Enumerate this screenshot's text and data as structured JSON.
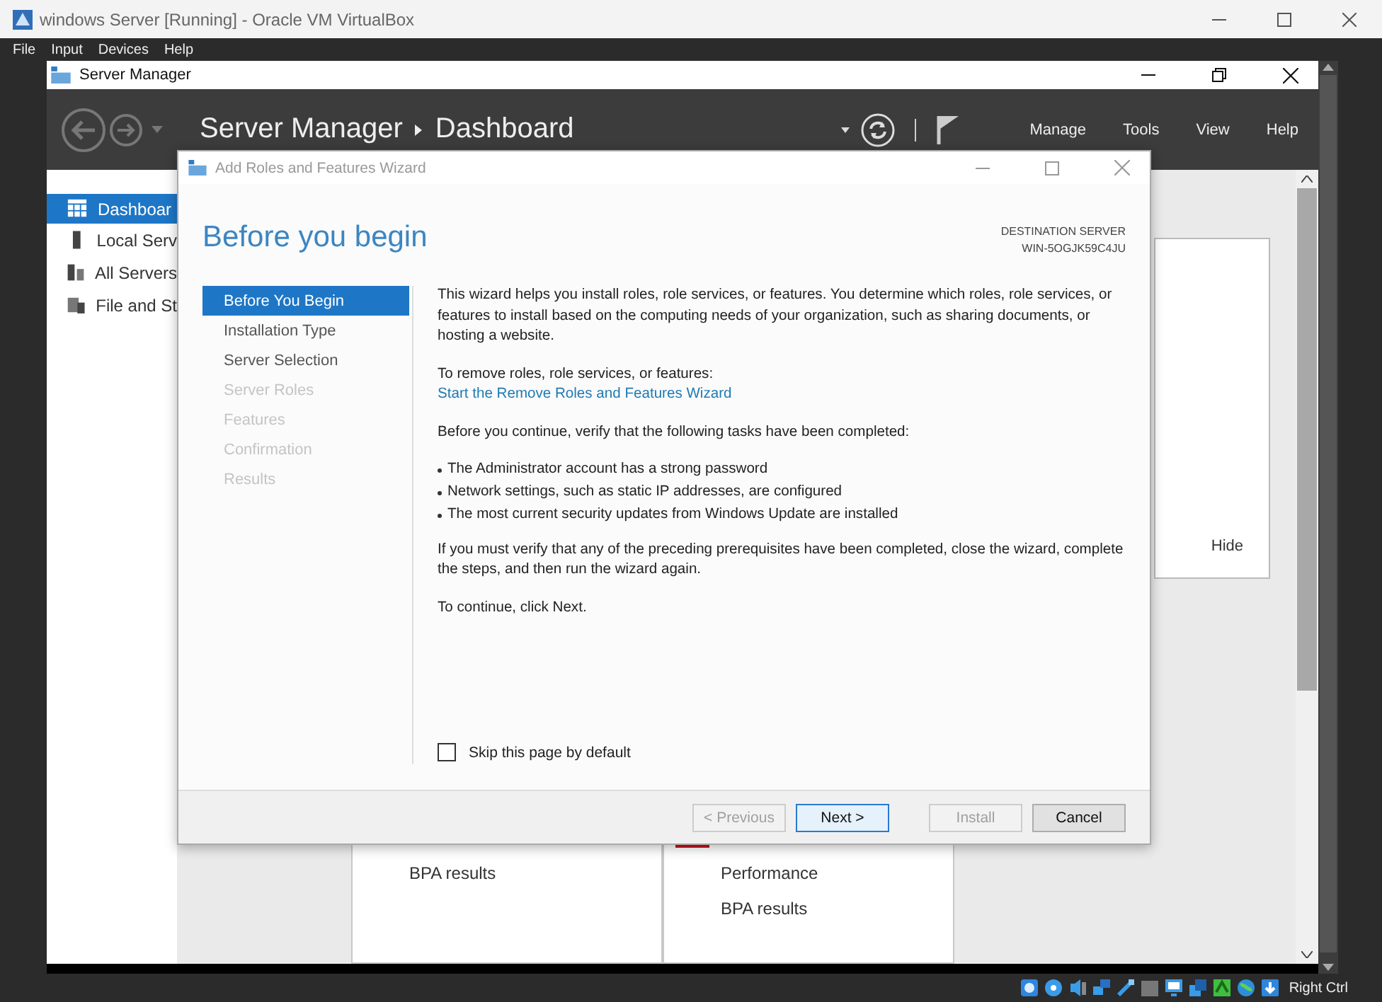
{
  "vbox": {
    "title": "windows Server [Running] - Oracle VM VirtualBox",
    "menu": [
      "File",
      "Input",
      "Devices",
      "Help"
    ],
    "host_key": "Right Ctrl"
  },
  "server_manager": {
    "title": "Server Manager",
    "breadcrumb": [
      "Server Manager",
      "Dashboard"
    ],
    "menu": [
      "Manage",
      "Tools",
      "View",
      "Help"
    ],
    "nav": [
      {
        "label": "Dashboar",
        "selected": true
      },
      {
        "label": "Local Serv",
        "selected": false
      },
      {
        "label": "All Servers",
        "selected": false
      },
      {
        "label": "File and St",
        "selected": false
      }
    ],
    "hide_button": "Hide",
    "tiles": [
      {
        "alert": false,
        "lines": [
          "BPA results"
        ]
      },
      {
        "alert": true,
        "lines": [
          "Performance",
          "BPA results"
        ]
      }
    ]
  },
  "wizard": {
    "title": "Add Roles and Features Wizard",
    "heading": "Before you begin",
    "destination_label": "DESTINATION SERVER",
    "destination_server": "WIN-5OGJK59C4JU",
    "steps": [
      {
        "label": "Before You Begin",
        "selected": true,
        "disabled": false
      },
      {
        "label": "Installation Type",
        "selected": false,
        "disabled": false
      },
      {
        "label": "Server Selection",
        "selected": false,
        "disabled": false
      },
      {
        "label": "Server Roles",
        "selected": false,
        "disabled": true
      },
      {
        "label": "Features",
        "selected": false,
        "disabled": true
      },
      {
        "label": "Confirmation",
        "selected": false,
        "disabled": true
      },
      {
        "label": "Results",
        "selected": false,
        "disabled": true
      }
    ],
    "intro": "This wizard helps you install roles, role services, or features. You determine which roles, role services, or features to install based on the computing needs of your organization, such as sharing documents, or hosting a website.",
    "remove_label": "To remove roles, role services, or features:",
    "remove_link": "Start the Remove Roles and Features Wizard",
    "verify_label": "Before you continue, verify that the following tasks have been completed:",
    "tasks": [
      "The Administrator account has a strong password",
      "Network settings, such as static IP addresses, are configured",
      "The most current security updates from Windows Update are installed"
    ],
    "verify_note": "If you must verify that any of the preceding prerequisites have been completed, close the wizard, complete the steps, and then run the wizard again.",
    "continue_note": "To continue, click Next.",
    "skip": {
      "label": "Skip this page by default",
      "checked": false
    },
    "buttons": [
      {
        "label": "< Previous",
        "disabled": true,
        "default": false
      },
      {
        "label": "Next >",
        "disabled": false,
        "default": true
      },
      {
        "label": "Install",
        "disabled": true,
        "default": false
      },
      {
        "label": "Cancel",
        "disabled": false,
        "default": false
      }
    ]
  }
}
